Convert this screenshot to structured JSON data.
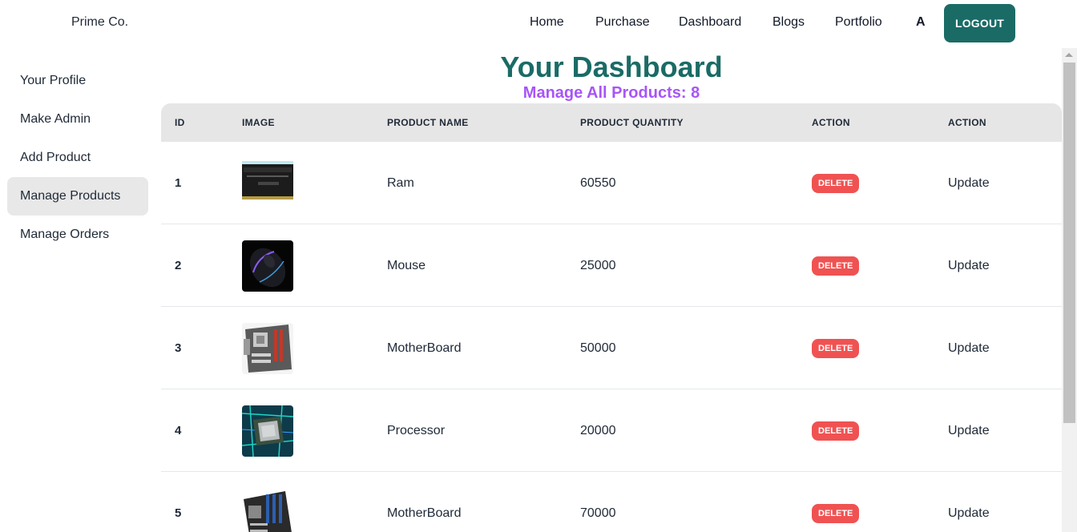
{
  "navbar": {
    "brand": "Prime Co.",
    "links": [
      "Home",
      "Purchase",
      "Dashboard",
      "Blogs",
      "Portfolio"
    ],
    "avatar": "A",
    "logout": "LOGOUT"
  },
  "sidebar": {
    "items": [
      "Your Profile",
      "Make Admin",
      "Add Product",
      "Manage Products",
      "Manage Orders"
    ],
    "active": "Manage Products"
  },
  "main": {
    "title": "Your Dashboard",
    "subtitle": "Manage All Products: 8"
  },
  "table": {
    "headers": [
      "ID",
      "IMAGE",
      "PRODUCT NAME",
      "PRODUCT QUANTITY",
      "ACTION",
      "ACTION"
    ],
    "rows": [
      {
        "id": "1",
        "image": "ram-image",
        "name": "Ram",
        "quantity": "60550",
        "delete": "DELETE",
        "update": "Update"
      },
      {
        "id": "2",
        "image": "mouse-image",
        "name": "Mouse",
        "quantity": "25000",
        "delete": "DELETE",
        "update": "Update"
      },
      {
        "id": "3",
        "image": "motherboard-image",
        "name": "MotherBoard",
        "quantity": "50000",
        "delete": "DELETE",
        "update": "Update"
      },
      {
        "id": "4",
        "image": "processor-image",
        "name": "Processor",
        "quantity": "20000",
        "delete": "DELETE",
        "update": "Update"
      },
      {
        "id": "5",
        "image": "motherboard-image",
        "name": "MotherBoard",
        "quantity": "70000",
        "delete": "DELETE",
        "update": "Update"
      }
    ]
  },
  "colors": {
    "accent": "#1a6b66",
    "subtitle": "#a855f7",
    "delete": "#f05252",
    "active_bg": "#e8e8e8",
    "header_bg": "#e6e6e6"
  }
}
